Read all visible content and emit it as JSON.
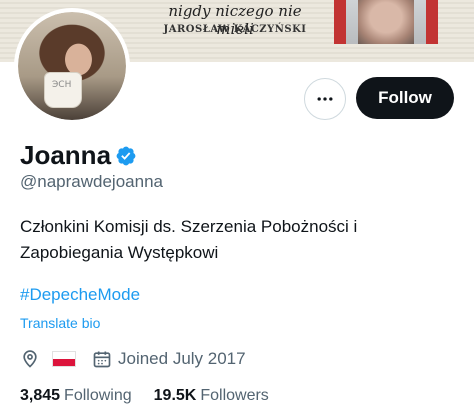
{
  "banner": {
    "quote": "nigdy niczego nie mieli",
    "author": "JAROSŁAW KACZYŃSKI"
  },
  "avatar": {
    "mug_text": "ЭСН"
  },
  "actions": {
    "more_icon": "more-horizontal-icon",
    "follow_label": "Follow"
  },
  "profile": {
    "name": "Joanna",
    "verified_icon": "verified-badge-icon",
    "handle": "@naprawdejoanna",
    "bio_line1": "Członkini Komisji ds. Szerzenia Pobożności i",
    "bio_line2": "Zapobiegania Występkowi",
    "hashtag": "#DepecheMode",
    "translate": "Translate bio",
    "location_icon": "location-pin-icon",
    "flag": "Poland flag",
    "calendar_icon": "calendar-icon",
    "joined": "Joined July 2017",
    "following_count": "3,845",
    "following_label": "Following",
    "followers_count": "19.5K",
    "followers_label": "Followers"
  },
  "colors": {
    "accent": "#1d9bf0",
    "text": "#0f1419",
    "muted": "#536471",
    "button": "#0f1419"
  }
}
